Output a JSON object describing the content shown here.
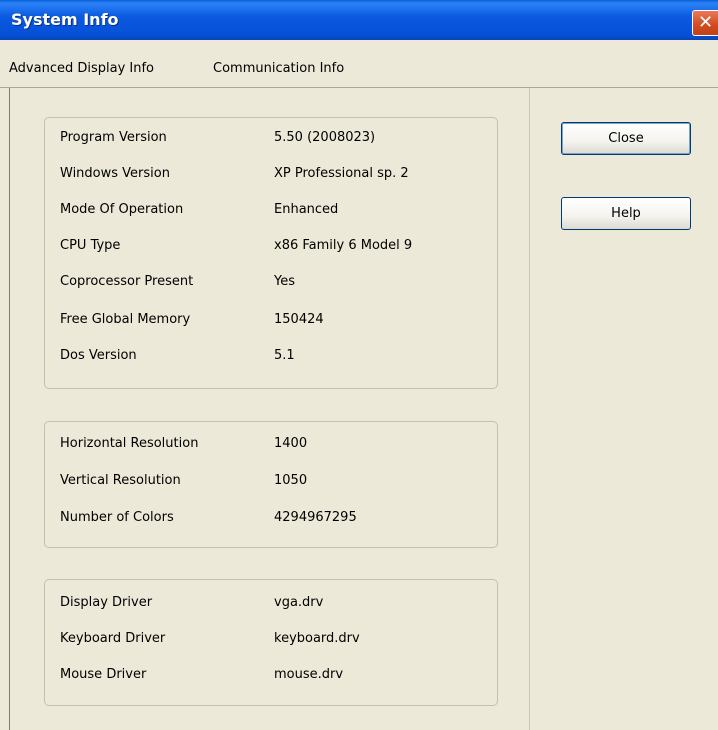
{
  "window": {
    "title": "System Info",
    "close_glyph": "✕"
  },
  "menu": [
    {
      "label": "Advanced Display Info"
    },
    {
      "label": "Communication Info"
    }
  ],
  "groups": [
    {
      "rows": [
        {
          "label": "Program Version",
          "value": "5.50 (2008023)"
        },
        {
          "label": "Windows Version",
          "value": "XP Professional sp. 2"
        },
        {
          "label": "Mode Of Operation",
          "value": "Enhanced"
        },
        {
          "label": "CPU Type",
          "value": "x86 Family 6 Model 9"
        },
        {
          "label": "Coprocessor Present",
          "value": "Yes"
        },
        {
          "label": "Free Global Memory",
          "value": "150424"
        },
        {
          "label": "Dos Version",
          "value": "5.1"
        }
      ]
    },
    {
      "rows": [
        {
          "label": "Horizontal Resolution",
          "value": "1400"
        },
        {
          "label": "Vertical Resolution",
          "value": "1050"
        },
        {
          "label": "Number of Colors",
          "value": "4294967295"
        }
      ]
    },
    {
      "rows": [
        {
          "label": "Display Driver",
          "value": "vga.drv"
        },
        {
          "label": "Keyboard Driver",
          "value": "keyboard.drv"
        },
        {
          "label": "Mouse Driver",
          "value": "mouse.drv"
        }
      ]
    }
  ],
  "buttons": {
    "close": "Close",
    "help": "Help"
  }
}
